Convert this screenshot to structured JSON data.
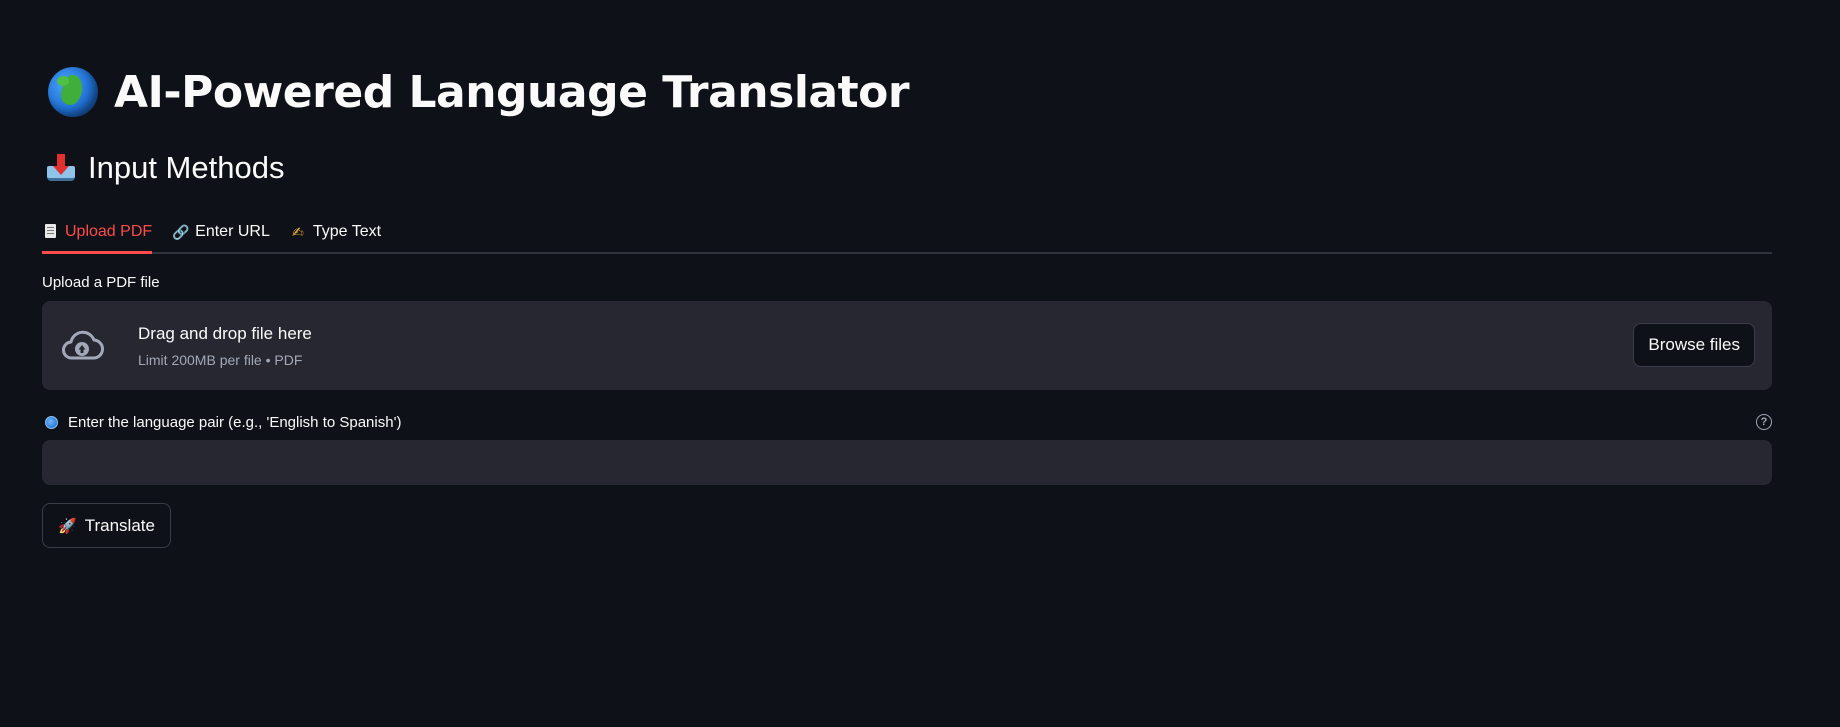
{
  "title": {
    "text": "AI-Powered Language Translator",
    "icon": "globe-africa-emoji"
  },
  "subheader": {
    "text": "Input Methods",
    "icon": "inbox-tray-emoji"
  },
  "tabs": [
    {
      "label": "Upload PDF",
      "icon": "page-facing-up-emoji",
      "active": true
    },
    {
      "label": "Enter URL",
      "icon": "link-emoji",
      "active": false
    },
    {
      "label": "Type Text",
      "icon": "writing-hand-emoji",
      "active": false
    }
  ],
  "uploader": {
    "label": "Upload a PDF file",
    "drop_text": "Drag and drop file here",
    "limit_text": "Limit 200MB per file • PDF",
    "browse_label": "Browse files",
    "icon": "cloud-upload-icon"
  },
  "language_pair": {
    "label": "Enter the language pair (e.g., 'English to Spanish')",
    "value": "",
    "placeholder": "",
    "help_icon": "question-circle-icon"
  },
  "translate_button": {
    "label": "Translate",
    "icon": "rocket-emoji"
  },
  "colors": {
    "background": "#0e1117",
    "surface": "#262730",
    "accent": "#ff4b4b",
    "text": "#fafafa",
    "muted_text": "#a3a8b8"
  }
}
